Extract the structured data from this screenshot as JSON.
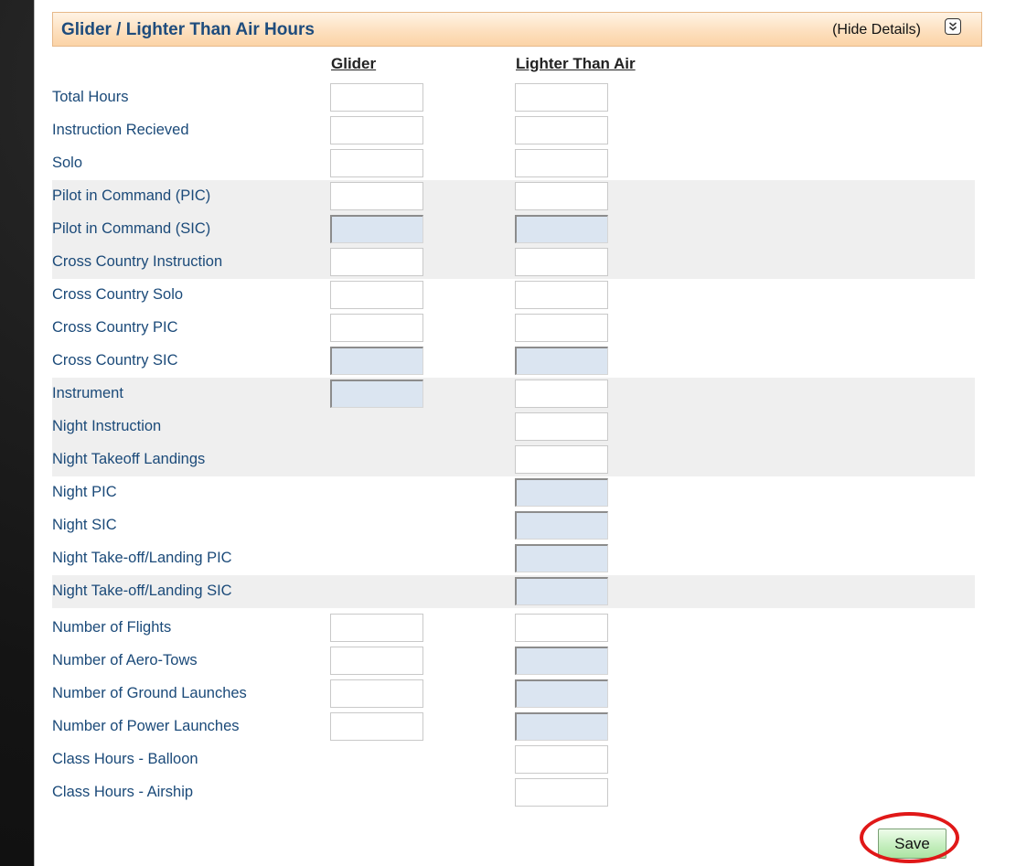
{
  "section": {
    "title": "Glider / Lighter Than Air Hours",
    "hide_details": "(Hide Details)",
    "collapse_icon": "double-chevron-down-icon"
  },
  "columns": {
    "glider": "Glider",
    "lighter_than_air": "Lighter Than Air"
  },
  "rows": [
    {
      "label": "Total Hours",
      "glider": "",
      "lta": ""
    },
    {
      "label": "Instruction Recieved",
      "glider": "",
      "lta": ""
    },
    {
      "label": "Solo",
      "glider": "",
      "lta": ""
    },
    {
      "label": "Pilot in Command (PIC)",
      "glider": "",
      "lta": ""
    },
    {
      "label": "Pilot in Command (SIC)",
      "glider": "",
      "lta": ""
    },
    {
      "label": "Cross Country Instruction",
      "glider": "",
      "lta": ""
    },
    {
      "label": "Cross Country Solo",
      "glider": "",
      "lta": ""
    },
    {
      "label": "Cross Country PIC",
      "glider": "",
      "lta": ""
    },
    {
      "label": "Cross Country SIC",
      "glider": "",
      "lta": ""
    },
    {
      "label": "Instrument",
      "glider": "",
      "lta": ""
    },
    {
      "label": "Night Instruction",
      "lta": ""
    },
    {
      "label": "Night Takeoff Landings",
      "lta": ""
    },
    {
      "label": "Night PIC",
      "lta": ""
    },
    {
      "label": "Night SIC",
      "lta": ""
    },
    {
      "label": "Night Take-off/Landing PIC",
      "lta": ""
    },
    {
      "label": "Night Take-off/Landing SIC",
      "lta": ""
    },
    {
      "label": "Number of Flights",
      "glider": "",
      "lta": ""
    },
    {
      "label": "Number of Aero-Tows",
      "glider": "",
      "lta": ""
    },
    {
      "label": "Number of Ground Launches",
      "glider": "",
      "lta": ""
    },
    {
      "label": "Number of Power Launches",
      "glider": "",
      "lta": ""
    },
    {
      "label": "Class Hours - Balloon",
      "lta": ""
    },
    {
      "label": "Class Hours - Airship",
      "lta": ""
    }
  ],
  "save_label": "Save",
  "colors": {
    "header_title": "#1e4c7d",
    "label_text": "#1b4a79",
    "disabled_field": "#dbe5f1",
    "save_button": "#c9f0c3",
    "highlight_ring": "#e01818"
  }
}
